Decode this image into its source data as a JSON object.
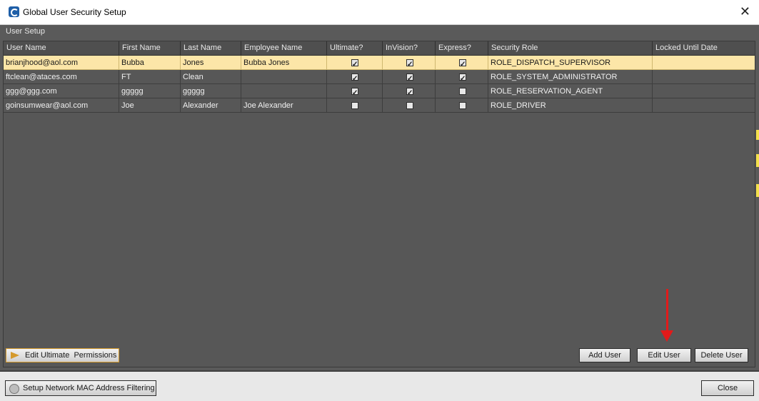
{
  "window": {
    "title": "Global User Security Setup",
    "close_glyph": "✕",
    "icon_name": "app-logo-icon"
  },
  "group": {
    "label": "User Setup"
  },
  "table": {
    "columns": [
      "User Name",
      "First Name",
      "Last Name",
      "Employee Name",
      "Ultimate?",
      "InVision?",
      "Express?",
      "Security Role",
      "Locked Until Date"
    ],
    "rows": [
      {
        "user_name": "brianjhood@aol.com",
        "first_name": "Bubba",
        "last_name": "Jones",
        "employee_name": "Bubba Jones",
        "ultimate": true,
        "invision": true,
        "express": true,
        "security_role": "ROLE_DISPATCH_SUPERVISOR",
        "locked_until": "",
        "selected": true
      },
      {
        "user_name": "ftclean@ataces.com",
        "first_name": "FT",
        "last_name": "Clean",
        "employee_name": "",
        "ultimate": true,
        "invision": true,
        "express": true,
        "security_role": "ROLE_SYSTEM_ADMINISTRATOR",
        "locked_until": "",
        "selected": false
      },
      {
        "user_name": "ggg@ggg.com",
        "first_name": "ggggg",
        "last_name": "ggggg",
        "employee_name": "",
        "ultimate": true,
        "invision": true,
        "express": false,
        "security_role": "ROLE_RESERVATION_AGENT",
        "locked_until": "",
        "selected": false
      },
      {
        "user_name": "goinsumwear@aol.com",
        "first_name": "Joe",
        "last_name": "Alexander",
        "employee_name": "Joe Alexander",
        "ultimate": false,
        "invision": false,
        "express": false,
        "security_role": "ROLE_DRIVER",
        "locked_until": "",
        "selected": false
      }
    ]
  },
  "buttons": {
    "edit_permissions": "Edit Ultimate  Permissions",
    "add_user": "Add User",
    "edit_user": "Edit User",
    "delete_user": "Delete User",
    "mac_filter": "Setup Network MAC Address Filtering",
    "close": "Close"
  },
  "colors": {
    "selected_row": "#fce6a8",
    "annotation_arrow": "#e21a1a",
    "active_button_border": "#d59a2c"
  }
}
